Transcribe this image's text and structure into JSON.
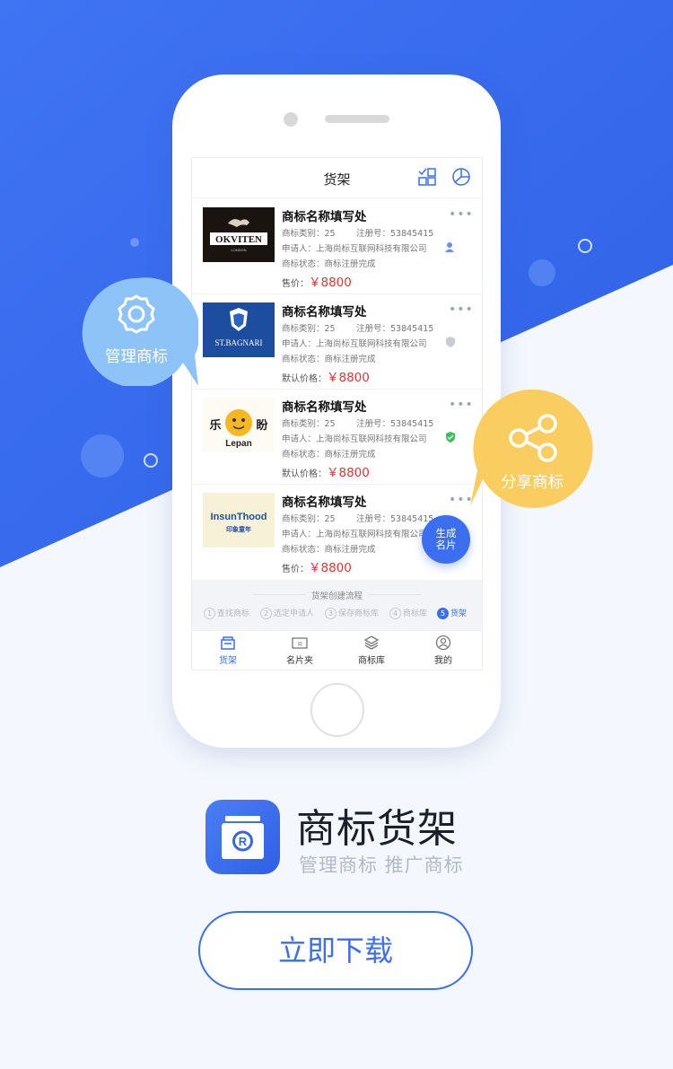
{
  "screen": {
    "nav_title": "货架",
    "cards": [
      {
        "logo_text": "OKVITEN",
        "logo_sub": "LONDON",
        "title": "商标名称填写处",
        "category": "商标类别：25",
        "reg_no": "注册号：53845415",
        "applicant": "申请人：上海尚标互联网科技有限公司",
        "status": "商标状态：商标注册完成",
        "price_label": "售价：",
        "price": "￥8800"
      },
      {
        "logo_text": "ST.BAGNARI",
        "title": "商标名称填写处",
        "category": "商标类别：25",
        "reg_no": "注册号：53845415",
        "applicant": "申请人：上海尚标互联网科技有限公司",
        "status": "商标状态：商标注册完成",
        "price_label": "默认价格：",
        "price": "￥8800"
      },
      {
        "logo_text": "乐盼",
        "logo_sub": "Lepan",
        "title": "商标名称填写处",
        "category": "商标类别：25",
        "reg_no": "注册号：53845415",
        "applicant": "申请人：上海尚标互联网科技有限公司",
        "status": "商标状态：商标注册完成",
        "price_label": "默认价格：",
        "price": "￥8800"
      },
      {
        "logo_text": "InsunThood",
        "logo_sub": "印象童年",
        "title": "商标名称填写处",
        "category": "商标类别：25",
        "reg_no": "注册号：53845415",
        "applicant": "申请人：上海尚标互联网科技有限公司",
        "status": "商标状态：商标注册完成",
        "price_label": "售价：",
        "price": "￥8800"
      }
    ],
    "flow": {
      "title": "货架创建流程",
      "steps": [
        {
          "n": "1",
          "label": "查找商标"
        },
        {
          "n": "2",
          "label": "选定申请人"
        },
        {
          "n": "3",
          "label": "保存商标库"
        },
        {
          "n": "4",
          "label": "商标库"
        },
        {
          "n": "5",
          "label": "货架"
        }
      ]
    },
    "tabs": [
      {
        "label": "货架",
        "icon": "shelf-icon"
      },
      {
        "label": "名片夹",
        "icon": "card-holder-icon"
      },
      {
        "label": "商标库",
        "icon": "layers-icon"
      },
      {
        "label": "我的",
        "icon": "user-icon"
      }
    ],
    "fab_label_1": "生成",
    "fab_label_2": "名片"
  },
  "bubbles": {
    "left": "管理商标",
    "right": "分享商标"
  },
  "app": {
    "name": "商标货架",
    "tagline": "管理商标  推广商标",
    "download": "立即下载"
  },
  "colors": {
    "brand_blue": "#3c6ef0",
    "price_red": "#e63232",
    "bubble_left": "#8ec3f7",
    "bubble_right": "#f9cd60"
  }
}
